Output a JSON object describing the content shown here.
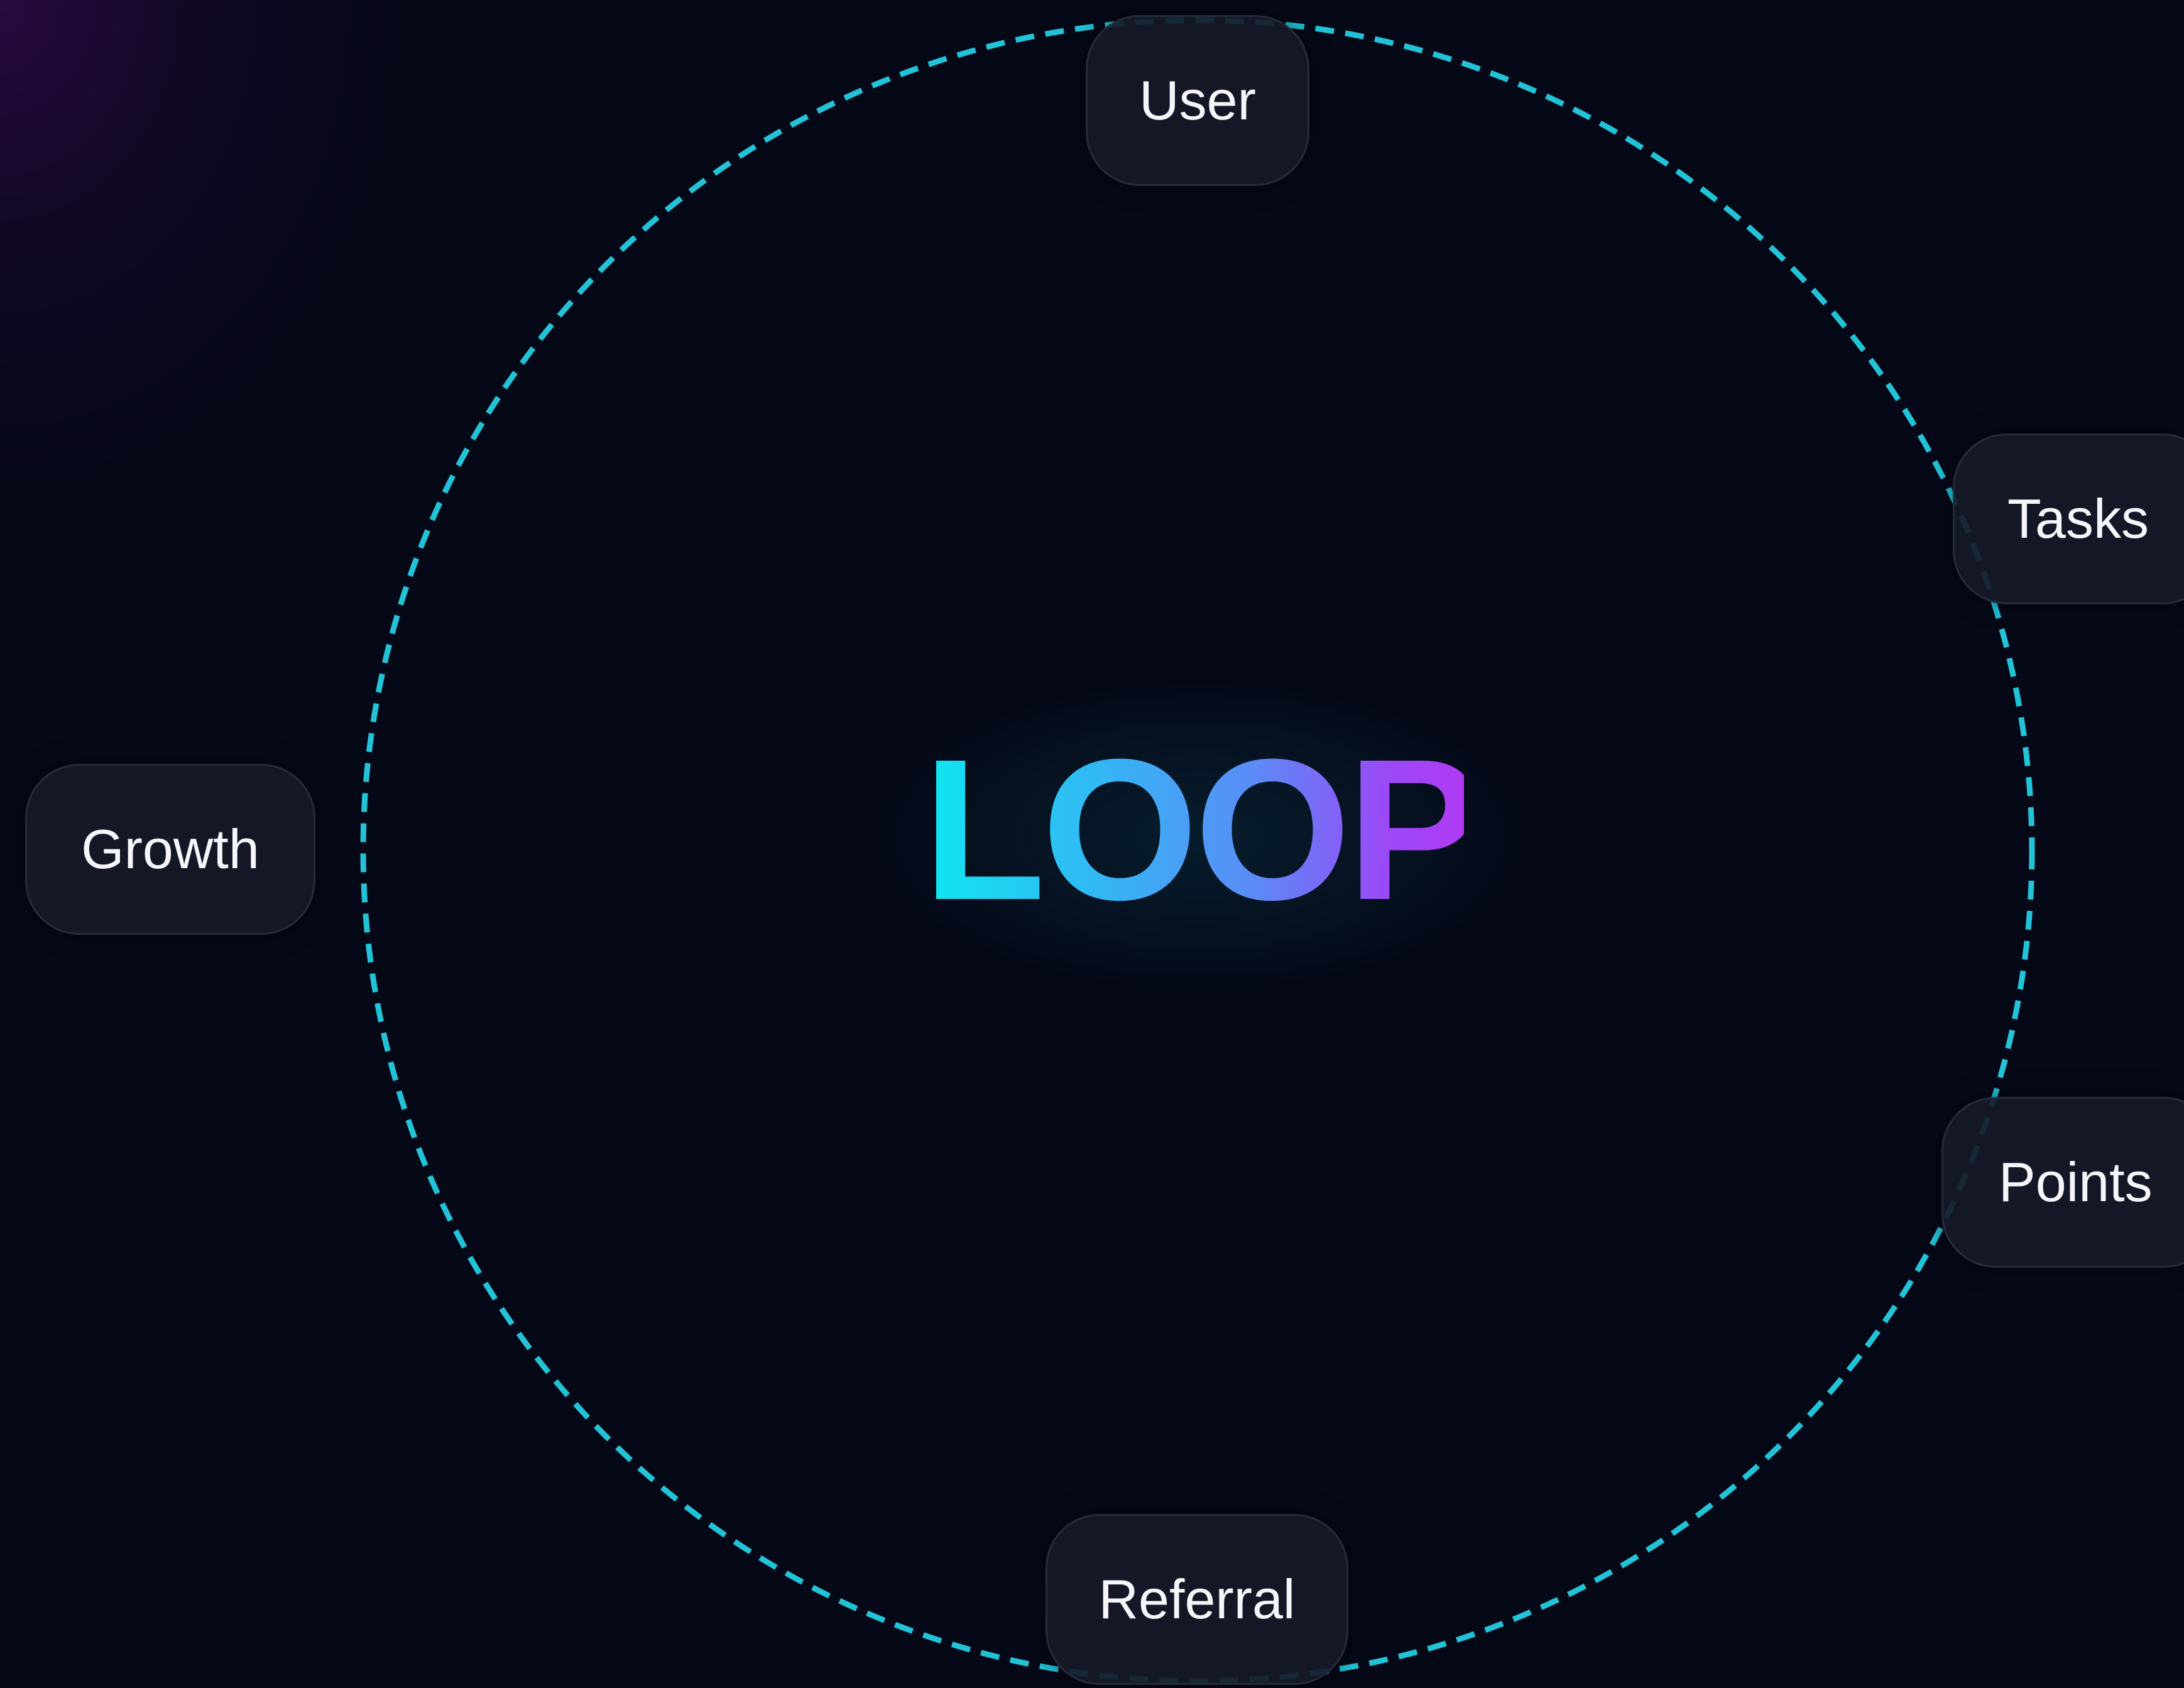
{
  "diagram": {
    "title": "LOOP",
    "ring_color": "#22c3d6",
    "title_gradient": [
      "#12e3f0",
      "#5a8cf6",
      "#b03af5"
    ],
    "background": "#050817",
    "nodes": {
      "user": "User",
      "tasks": "Tasks",
      "points": "Points",
      "referral": "Referral",
      "growth": "Growth"
    }
  }
}
